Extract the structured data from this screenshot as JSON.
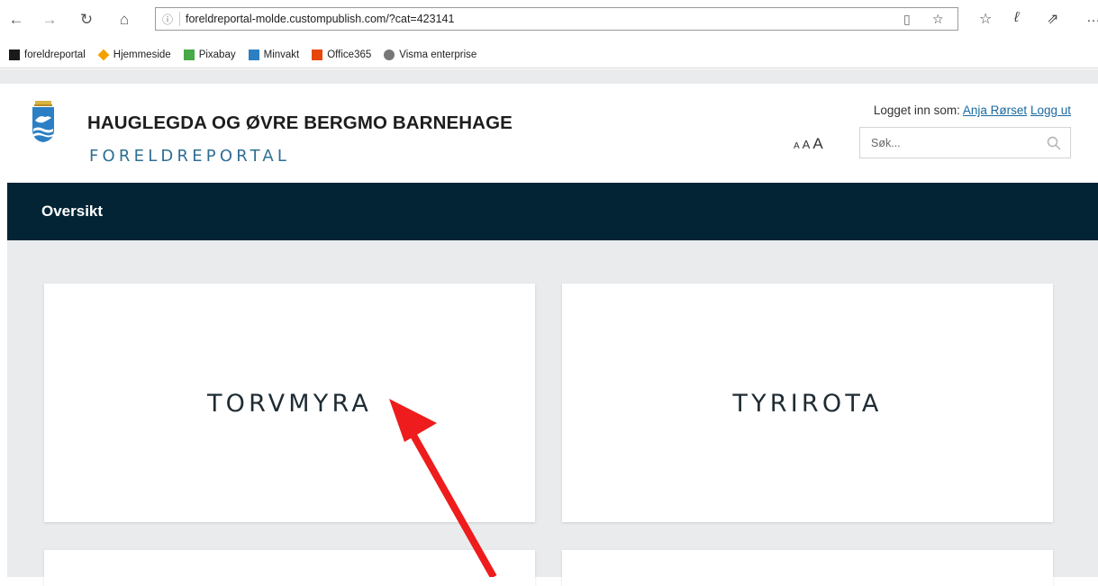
{
  "browser": {
    "url": "foreldreportal-molde.custompublish.com/?cat=423141",
    "favorites": [
      {
        "label": "foreldreportal",
        "icon": "ep-favicon",
        "color": "#1a1a1a"
      },
      {
        "label": "Hjemmeside",
        "icon": "diamond-favicon",
        "color": "#f2a100"
      },
      {
        "label": "Pixabay",
        "icon": "pixabay-favicon",
        "color": "#48a947"
      },
      {
        "label": "Minvakt",
        "icon": "minvakt-favicon",
        "color": "#2d7fc1"
      },
      {
        "label": "Office365",
        "icon": "office-favicon",
        "color": "#e8470b"
      },
      {
        "label": "Visma enterprise",
        "icon": "visma-favicon",
        "color": "#777777"
      }
    ]
  },
  "header": {
    "title": "HAUGLEGDA OG ØVRE BERGMO BARNEHAGE",
    "subtitle": "FORELDREPORTAL",
    "login_prefix": "Logget inn som:",
    "user_name": "Anja Rørset",
    "logout_label": "Logg ut",
    "font_small": "A",
    "font_mid": "A",
    "font_large": "A",
    "search_placeholder": "Søk..."
  },
  "nav": {
    "overview_label": "Oversikt"
  },
  "cards": [
    {
      "label": "TORVMYRA"
    },
    {
      "label": "TYRIROTA"
    }
  ],
  "colors": {
    "nav_bg": "#022435",
    "accent": "#2e6f92",
    "page_bg": "#eaebed",
    "annotation_arrow": "#ee1c1c"
  }
}
